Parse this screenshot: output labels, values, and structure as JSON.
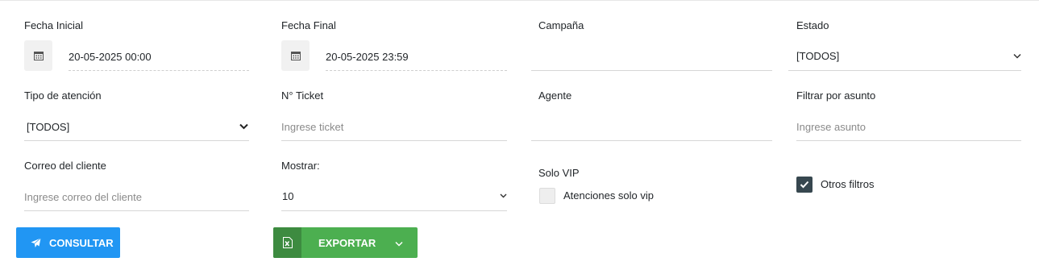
{
  "filters": {
    "fecha_inicial": {
      "label": "Fecha Inicial",
      "value": "20-05-2025 00:00"
    },
    "fecha_final": {
      "label": "Fecha Final",
      "value": "20-05-2025 23:59"
    },
    "campana": {
      "label": "Campaña",
      "value": ""
    },
    "estado": {
      "label": "Estado",
      "value": "[TODOS]"
    },
    "tipo_atencion": {
      "label": "Tipo de atención",
      "value": "[TODOS]"
    },
    "ticket": {
      "label": "N° Ticket",
      "placeholder": "Ingrese ticket"
    },
    "agente": {
      "label": "Agente",
      "value": ""
    },
    "asunto": {
      "label": "Filtrar por asunto",
      "placeholder": "Ingrese asunto"
    },
    "correo": {
      "label": "Correo del cliente",
      "placeholder": "Ingrese correo del cliente"
    },
    "mostrar": {
      "label": "Mostrar:",
      "value": "10"
    },
    "solo_vip": {
      "label": "Solo VIP",
      "checkbox_label": "Atenciones solo vip",
      "checked": false
    },
    "otros_filtros": {
      "checkbox_label": "Otros filtros",
      "checked": true
    }
  },
  "actions": {
    "consultar_label": "CONSULTAR",
    "exportar_label": "EXPORTAR"
  },
  "icons": {
    "calendar": "calendar-icon",
    "chevron": "chevron-down-icon",
    "send": "paper-plane-icon",
    "excel": "excel-file-icon",
    "check": "check-icon"
  },
  "colors": {
    "primary": "#2196f3",
    "success": "#4caf50",
    "success_dark": "#3d8b40",
    "checkbox_checked": "#37474f"
  }
}
